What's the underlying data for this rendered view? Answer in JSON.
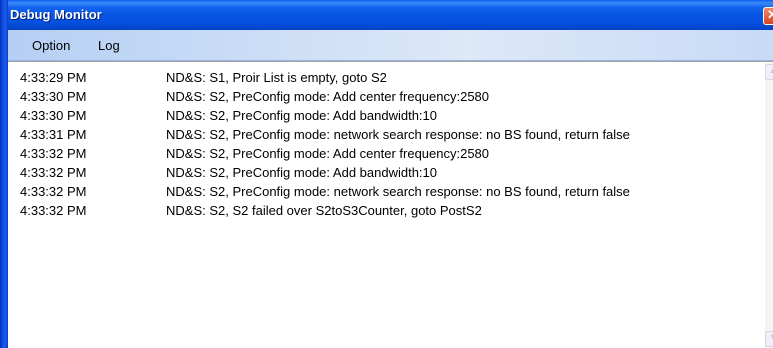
{
  "window": {
    "title": "Debug Monitor",
    "close_glyph": "✕"
  },
  "menu": {
    "option_label": "Option",
    "log_label": "Log"
  },
  "log": [
    {
      "time": "4:33:29 PM",
      "message": "ND&S: S1, Proir List is empty, goto S2"
    },
    {
      "time": "4:33:30 PM",
      "message": "ND&S: S2, PreConfig mode: Add center frequency:2580"
    },
    {
      "time": "4:33:30 PM",
      "message": "ND&S: S2, PreConfig mode: Add bandwidth:10"
    },
    {
      "time": "4:33:31 PM",
      "message": "ND&S: S2, PreConfig mode: network search response: no BS found, return false"
    },
    {
      "time": "4:33:32 PM",
      "message": "ND&S: S2, PreConfig mode: Add center frequency:2580"
    },
    {
      "time": "4:33:32 PM",
      "message": "ND&S: S2, PreConfig mode: Add bandwidth:10"
    },
    {
      "time": "4:33:32 PM",
      "message": "ND&S: S2, PreConfig mode: network search response: no BS found, return false"
    },
    {
      "time": "4:33:32 PM",
      "message": "ND&S: S2, S2 failed over S2toS3Counter, goto PostS2"
    }
  ],
  "scrollbar": {
    "up_glyph": "▲",
    "down_glyph": "▼"
  },
  "colors": {
    "titlebar": "#0a55e4",
    "menubar": "#c9dcf6",
    "close_button": "#d8451f"
  }
}
